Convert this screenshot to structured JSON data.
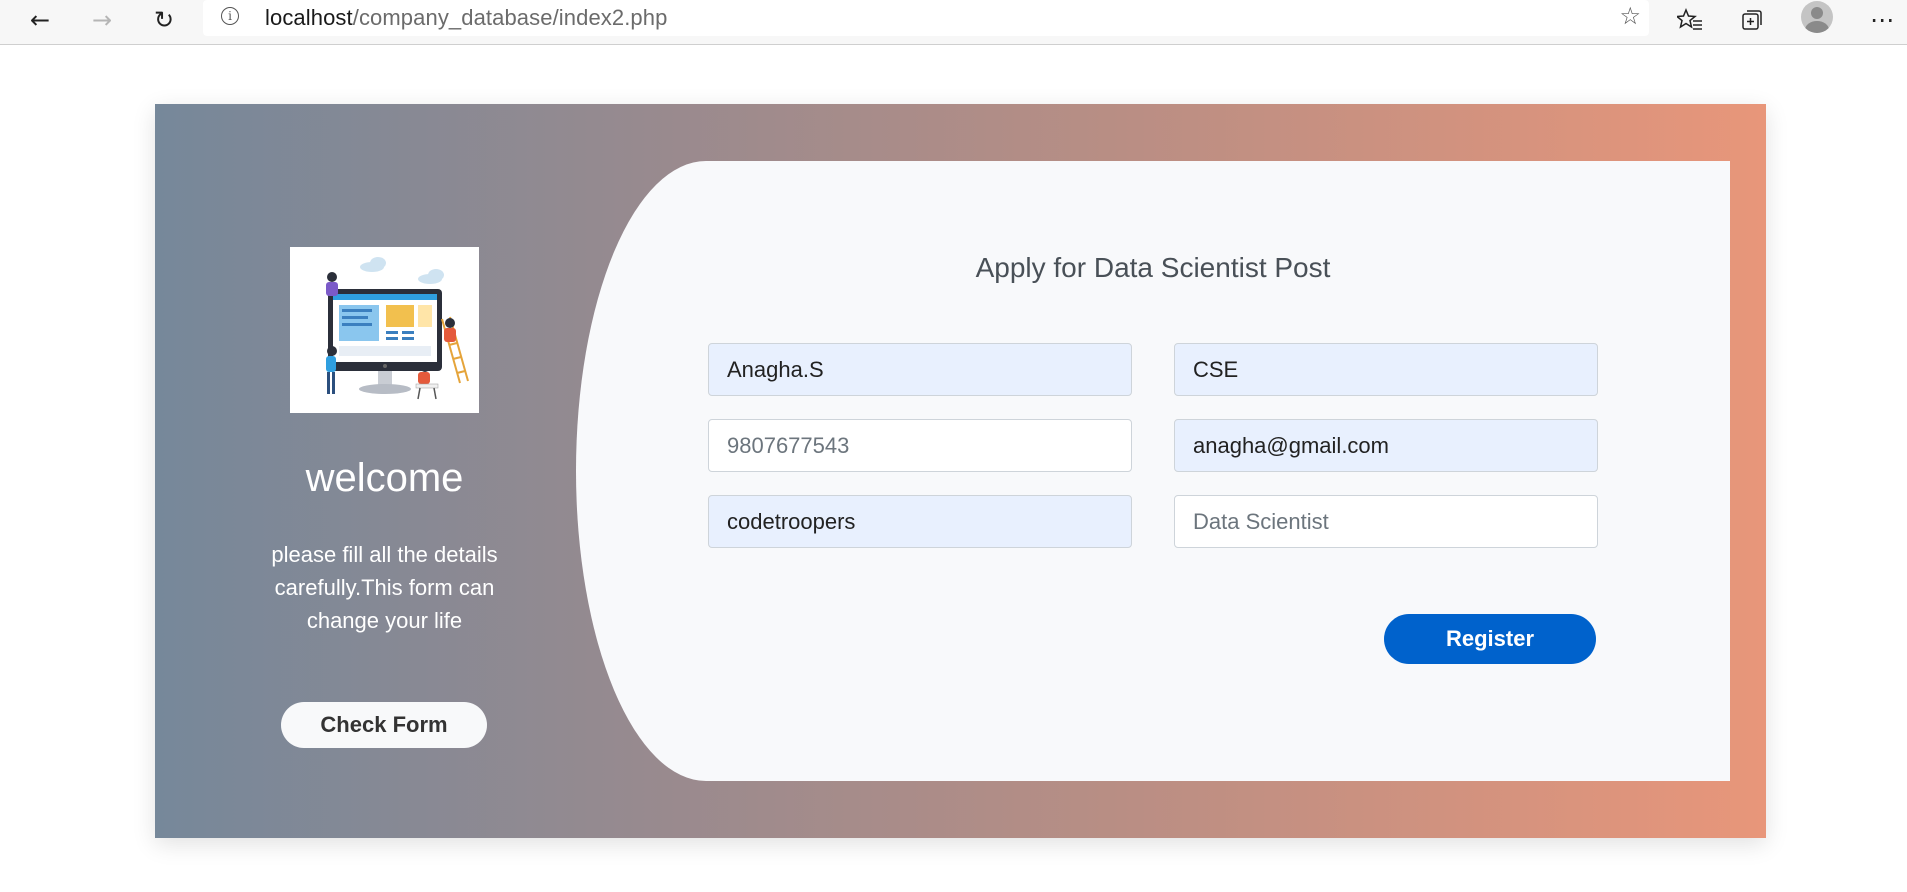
{
  "browser": {
    "url_host": "localhost",
    "url_path": "/company_database/index2.php",
    "back_icon": "back-arrow-icon",
    "forward_icon": "forward-arrow-icon",
    "refresh_icon": "refresh-icon",
    "info_icon": "info-icon",
    "star_icon": "star-icon",
    "favorites_icon": "favorites-icon",
    "collections_icon": "collections-icon",
    "profile_icon": "profile-avatar-icon",
    "more_icon": "more-options-icon"
  },
  "sidebar": {
    "welcome": "welcome",
    "intro": "please fill all the details carefully.This form can change your life",
    "check_button": "Check Form",
    "illustration": "web-design-illustration"
  },
  "form": {
    "title": "Apply for Data Scientist Post",
    "fields": {
      "name": {
        "value": "Anagha.S"
      },
      "department": {
        "value": "CSE"
      },
      "phone": {
        "placeholder": "9807677543"
      },
      "email": {
        "value": "anagha@gmail.com"
      },
      "company": {
        "value": "codetroopers"
      },
      "post": {
        "placeholder": "Data Scientist"
      }
    },
    "register_button": "Register"
  },
  "colors": {
    "gradient_start": "#76889a",
    "gradient_end": "#e8967a",
    "register_blue": "#0062cc",
    "autofill_bg": "#e8f0fe"
  }
}
